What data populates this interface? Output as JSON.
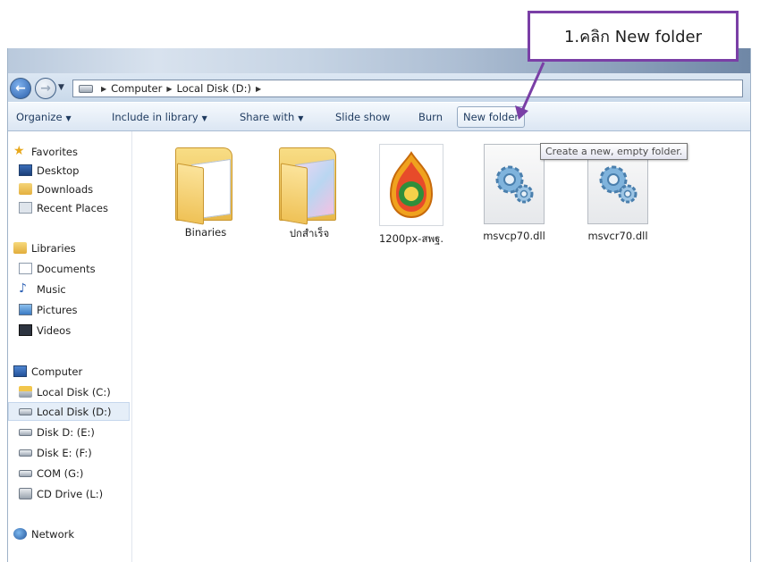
{
  "annotation": {
    "text": "1.คลิก New folder",
    "color": "#7a3fa6"
  },
  "address": {
    "crumbs": [
      "Computer",
      "Local Disk (D:)"
    ]
  },
  "toolbar": {
    "organize": "Organize",
    "include": "Include in library",
    "share": "Share with",
    "slideshow": "Slide show",
    "burn": "Burn",
    "new_folder": "New folder"
  },
  "tooltip": "Create a new, empty folder.",
  "sidebar": {
    "favorites": "Favorites",
    "desktop": "Desktop",
    "downloads": "Downloads",
    "recent": "Recent Places",
    "libraries": "Libraries",
    "documents": "Documents",
    "music": "Music",
    "pictures": "Pictures",
    "videos": "Videos",
    "computer": "Computer",
    "disk_c": "Local Disk (C:)",
    "disk_d": "Local Disk (D:)",
    "disk_e": "Disk D: (E:)",
    "disk_f": "Disk E: (F:)",
    "disk_g": "COM (G:)",
    "disk_l": "CD Drive (L:)",
    "network": "Network"
  },
  "files": [
    {
      "name": "Binaries",
      "icon": "folder-icon"
    },
    {
      "name": "ปกสำเร็จ",
      "icon": "folder-icon"
    },
    {
      "name": "1200px-สพฐ.",
      "icon": "image-file-icon"
    },
    {
      "name": "msvcp70.dll",
      "icon": "dll-file-icon"
    },
    {
      "name": "msvcr70.dll",
      "icon": "dll-file-icon"
    }
  ]
}
